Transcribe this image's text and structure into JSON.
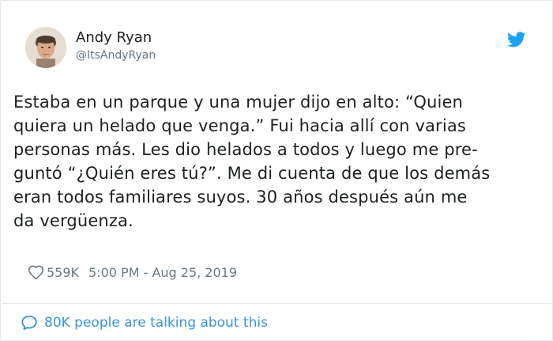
{
  "author": {
    "display_name": "Andy Ryan",
    "handle": "@ItsAndyRyan",
    "avatar_icon": "profile-photo"
  },
  "tweet": {
    "lines": [
      "Estaba en un parque y una mujer dijo en alto: “Quien",
      "quiera un helado que venga.” Fui hacia allí con varias",
      "personas más. Les dio helados a todos y luego me pre-",
      "guntó “¿Quién eres tú?”. Me di cuenta de que los demás",
      "eran todos familiares suyos. 30 años después aún me",
      "da vergüenza."
    ]
  },
  "meta": {
    "like_icon": "heart-outline",
    "likes": "559K",
    "timestamp": "5:00 PM - Aug 25, 2019"
  },
  "footer": {
    "icon": "speech-bubble",
    "text": "80K people are talking about this"
  },
  "colors": {
    "text": "#1c2022",
    "muted": "#697882",
    "twitter_blue": "#1da1f2",
    "link_blue": "#3b94d9",
    "border": "#e1e8ed"
  }
}
